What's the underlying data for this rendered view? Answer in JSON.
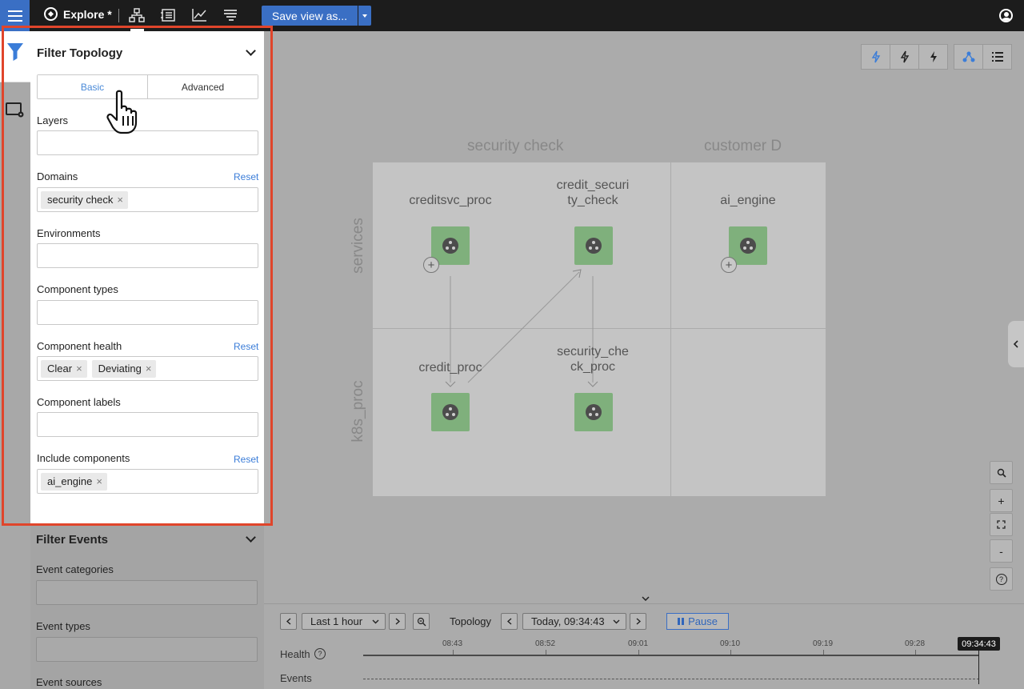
{
  "topbar": {
    "app_title": "Explore *",
    "save_label": "Save view as...",
    "icons": [
      "menu-icon",
      "compass-icon",
      "topology-icon",
      "components-icon",
      "metrics-icon",
      "events-icon",
      "user-icon"
    ]
  },
  "filter_topology": {
    "title": "Filter Topology",
    "tabs": [
      "Basic",
      "Advanced"
    ],
    "active_tab": "Basic",
    "layers": {
      "label": "Layers",
      "value": ""
    },
    "domains": {
      "label": "Domains",
      "reset": "Reset",
      "chips": [
        "security check"
      ]
    },
    "environments": {
      "label": "Environments",
      "value": ""
    },
    "component_types": {
      "label": "Component types",
      "value": ""
    },
    "component_health": {
      "label": "Component health",
      "reset": "Reset",
      "chips": [
        "Clear",
        "Deviating"
      ]
    },
    "component_labels": {
      "label": "Component labels",
      "value": ""
    },
    "include_components": {
      "label": "Include components",
      "reset": "Reset",
      "chips": [
        "ai_engine"
      ]
    }
  },
  "filter_events": {
    "title": "Filter Events",
    "event_categories": {
      "label": "Event categories"
    },
    "event_types": {
      "label": "Event types"
    },
    "event_sources": {
      "label": "Event sources"
    }
  },
  "topology": {
    "columns": [
      "security check",
      "customer D"
    ],
    "rows": [
      "services",
      "k8s_proc"
    ],
    "nodes": [
      {
        "label": "creditsvc_proc",
        "health": "Clear",
        "color": "#7fb07c"
      },
      {
        "label": "credit_securi\nty_check",
        "health": "Clear",
        "color": "#7fb07c"
      },
      {
        "label": "ai_engine",
        "health": "Clear",
        "color": "#7fb07c"
      },
      {
        "label": "credit_proc",
        "health": "Clear",
        "color": "#7fb07c"
      },
      {
        "label": "security_che\nck_proc",
        "health": "Clear",
        "color": "#7fb07c"
      }
    ]
  },
  "timeline": {
    "range": "Last 1 hour",
    "mode_label": "Topology",
    "time": "Today, 09:34:43",
    "pause_label": "Pause",
    "ticks": [
      "08:43",
      "08:52",
      "09:01",
      "09:10",
      "09:19",
      "09:28"
    ],
    "now": "09:34:43",
    "health_label": "Health",
    "events_label": "Events"
  },
  "zoom": {
    "plus": "+",
    "minus": "-",
    "help": "?"
  }
}
